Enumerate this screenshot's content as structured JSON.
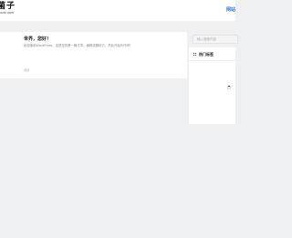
{
  "header": {
    "logo_main": "菌子",
    "logo_sub": "ucd.com",
    "nav_link": "网站"
  },
  "post": {
    "title": "世界，您好！",
    "excerpt": "欢迎使用WordPress。这是您的第一篇文章。编辑或删除它，然后开始写作吧！",
    "meta": "阅读"
  },
  "sidebar": {
    "search_placeholder": "输入搜索内容",
    "widget_title": "热门标签"
  }
}
